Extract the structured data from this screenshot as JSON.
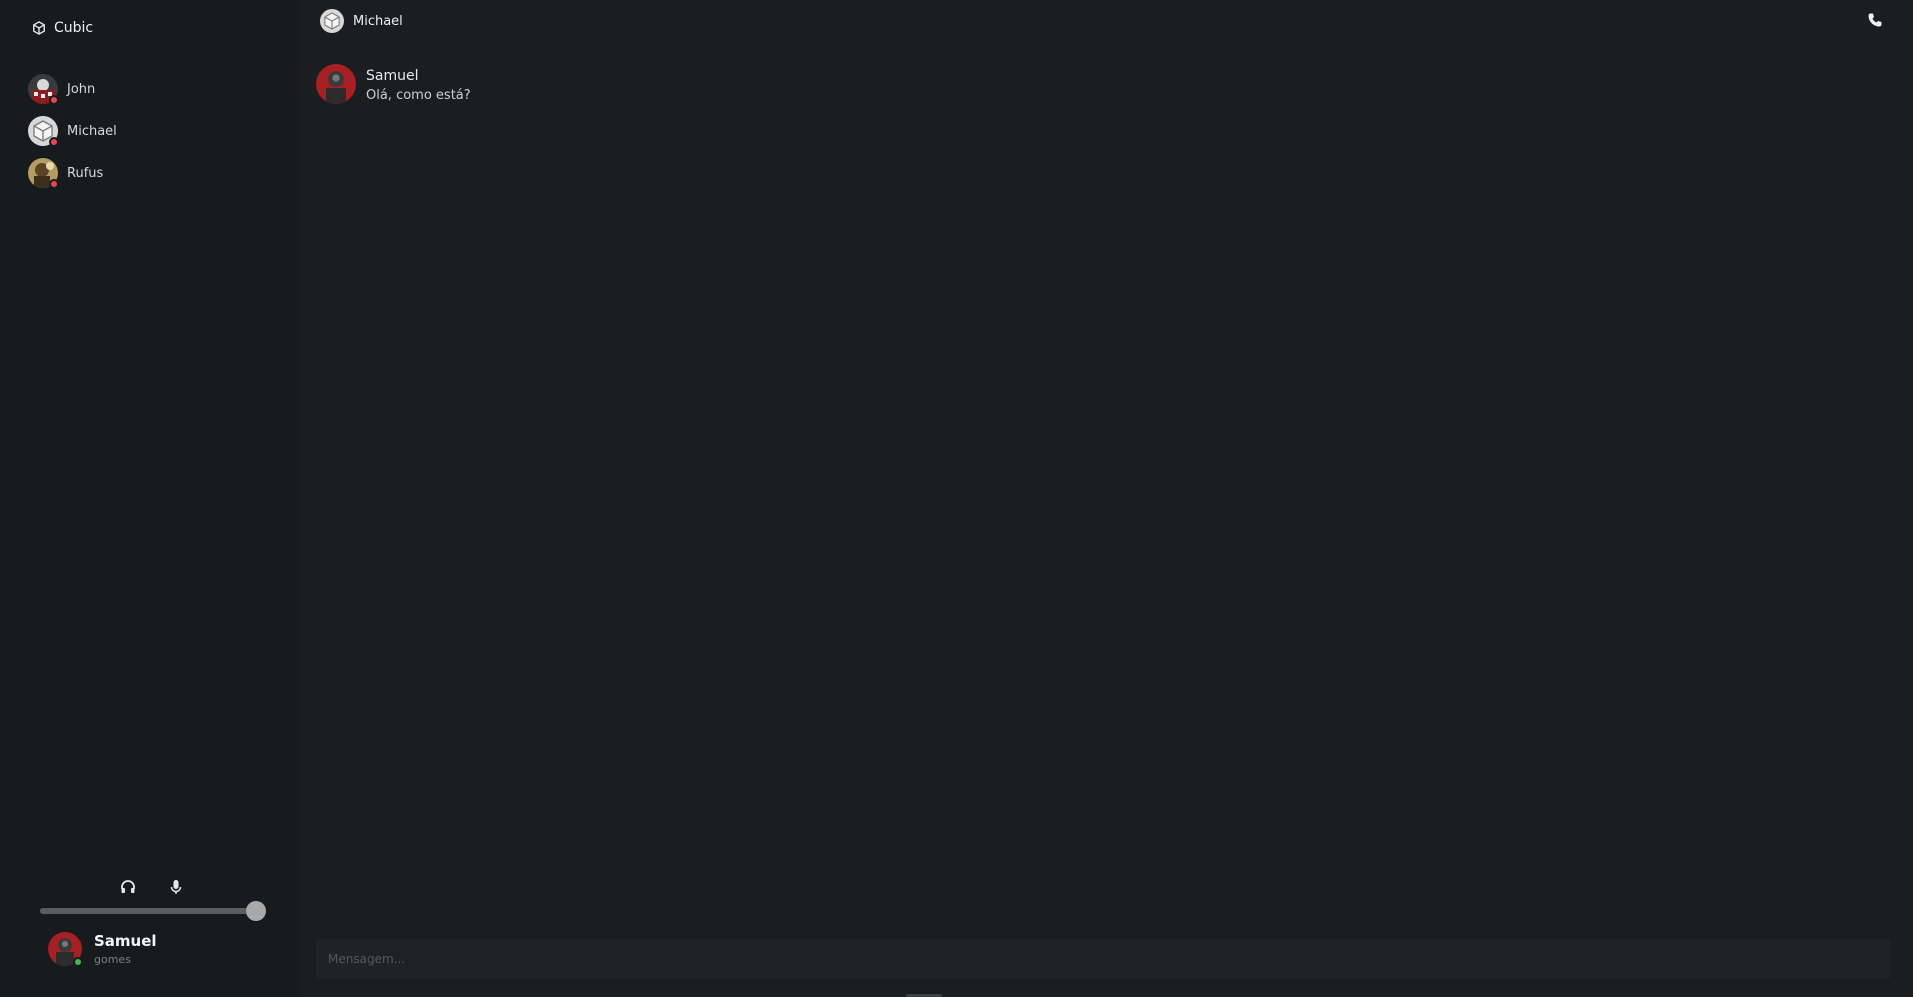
{
  "app": {
    "brand_name": "Cubic",
    "brand_icon": "cube-icon"
  },
  "sidebar": {
    "dms": [
      {
        "name": "John",
        "status_color": "#e5484d"
      },
      {
        "name": "Michael",
        "status_color": "#e5484d"
      },
      {
        "name": "Rufus",
        "status_color": "#e5484d"
      }
    ]
  },
  "controls": {
    "headphones_icon": "headphones-icon",
    "mic_icon": "microphone-icon",
    "volume_fraction": 0.98
  },
  "user": {
    "name": "Samuel",
    "subtitle": "gomes",
    "status_color": "#3fb950"
  },
  "chat": {
    "title": "Michael",
    "call_icon": "phone-icon",
    "messages": [
      {
        "author": "Samuel",
        "text": "Olá, como está?"
      }
    ],
    "composer_placeholder": "Mensagem..."
  },
  "colors": {
    "accent_online": "#3fb950",
    "accent_offline": "#e5484d"
  }
}
